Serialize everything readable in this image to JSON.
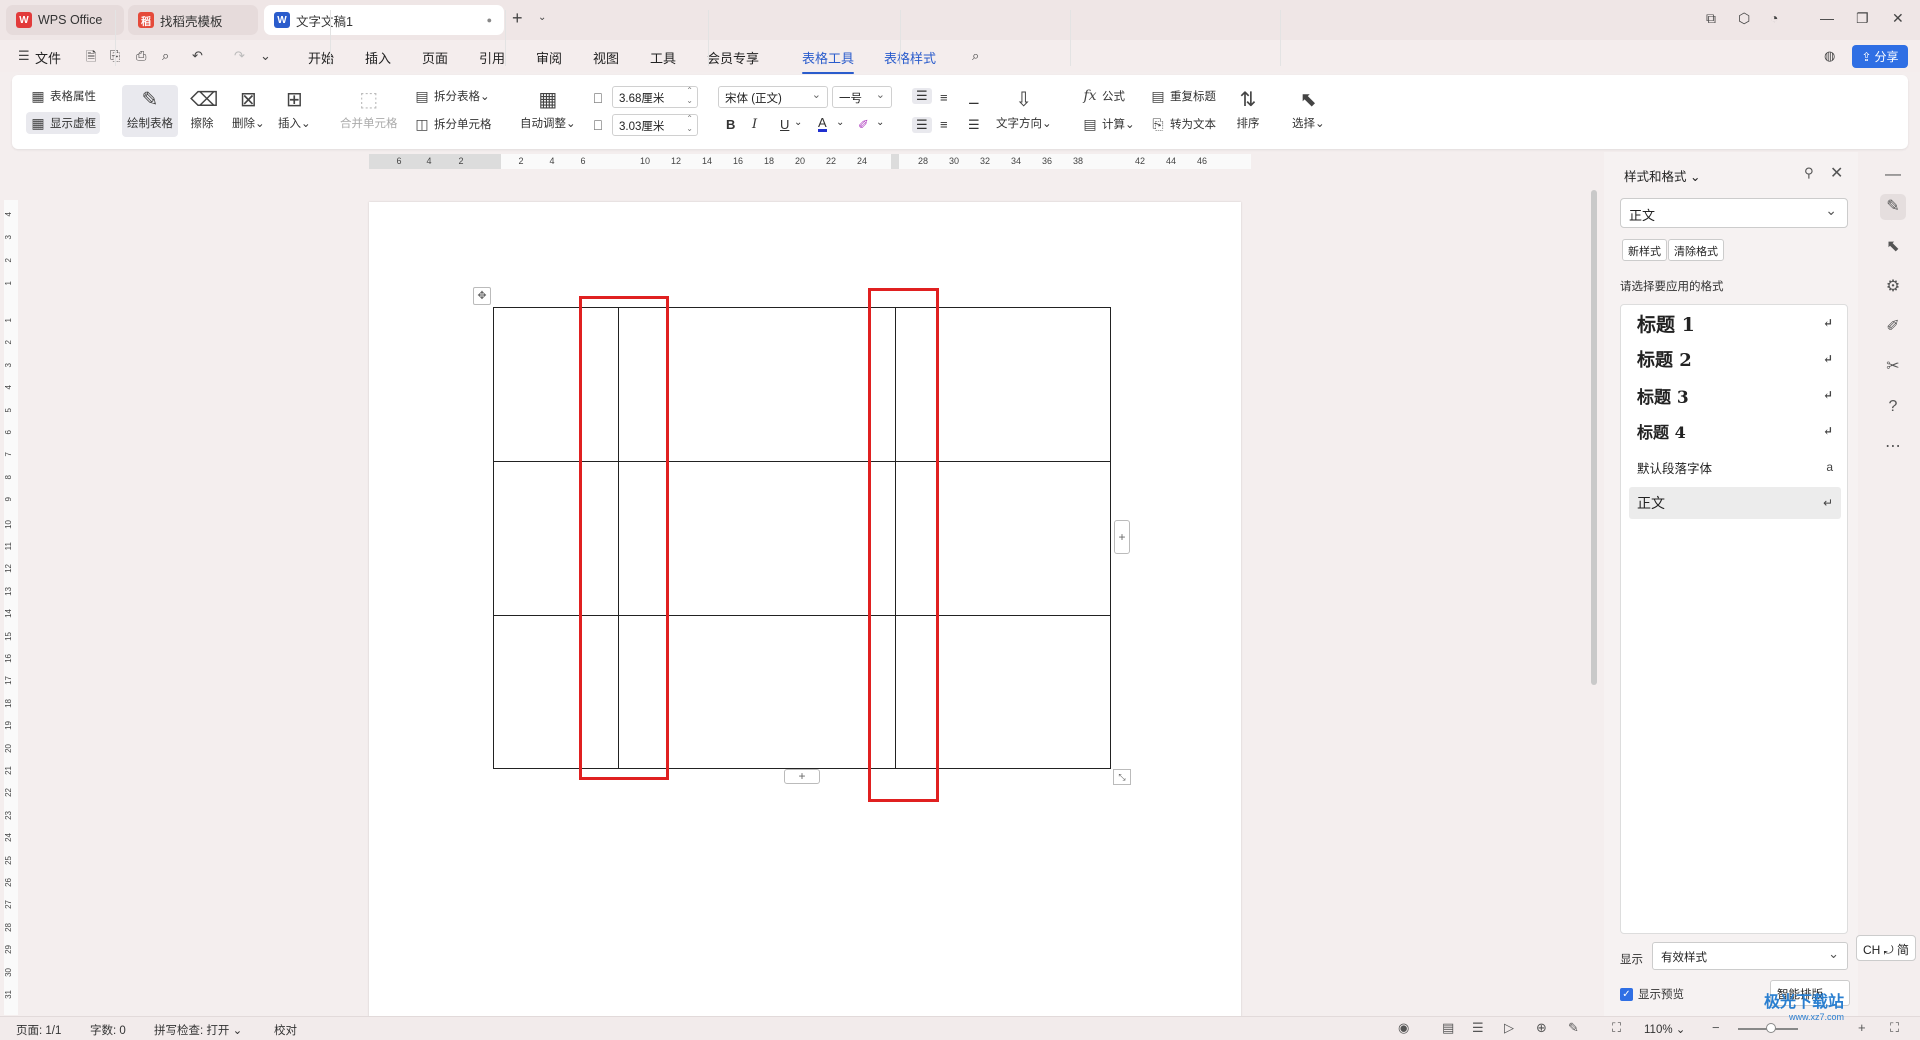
{
  "tabs": [
    {
      "label": "WPS Office",
      "icon": "wps-logo-icon"
    },
    {
      "label": "找稻壳模板",
      "icon": "docer-icon"
    },
    {
      "label": "文字文稿1",
      "icon": "writer-doc-icon",
      "modified_dot": "●"
    }
  ],
  "menu": {
    "file": "文件",
    "items": [
      "开始",
      "插入",
      "页面",
      "引用",
      "审阅",
      "视图",
      "工具",
      "会员专享",
      "表格工具",
      "表格样式"
    ],
    "active": "表格工具",
    "share": "分享"
  },
  "ribbon": {
    "table_props": "表格属性",
    "show_grid": "显示虚框",
    "draw_table": "绘制表格",
    "erase": "擦除",
    "delete": "删除",
    "insert": "插入",
    "merge_cells": "合并单元格",
    "split_table": "拆分表格",
    "split_cells": "拆分单元格",
    "auto_fit": "自动调整",
    "width_value": "3.68厘米",
    "height_value": "3.03厘米",
    "font_name": "宋体 (正文)",
    "font_size": "一号",
    "bold": "B",
    "italic": "I",
    "underline": "U",
    "font_color": "A",
    "text_direction": "文字方向",
    "formula": "公式",
    "calculate": "计算",
    "repeat_header": "重复标题",
    "to_text": "转为文本",
    "sort": "排序",
    "select": "选择"
  },
  "ruler": {
    "h_marks": [
      "6",
      "4",
      "2",
      "2",
      "4",
      "6",
      "10",
      "12",
      "14",
      "16",
      "18",
      "20",
      "22",
      "24",
      "28",
      "30",
      "32",
      "34",
      "36",
      "38",
      "42",
      "44",
      "46"
    ],
    "v_marks": [
      "4",
      "3",
      "2",
      "1",
      "1",
      "2",
      "3",
      "4",
      "5",
      "6",
      "7",
      "8",
      "9",
      "10",
      "11",
      "12",
      "13",
      "14",
      "15",
      "16",
      "17",
      "18",
      "19",
      "20",
      "21",
      "22",
      "23",
      "24",
      "25",
      "26",
      "27",
      "28",
      "29",
      "30",
      "31"
    ]
  },
  "panel": {
    "title": "样式和格式",
    "current_style": "正文",
    "new_style": "新样式",
    "clear_format": "清除格式",
    "apply_label": "请选择要应用的格式",
    "styles": [
      {
        "name": "标题  1",
        "mark": "↵"
      },
      {
        "name": "标题  2",
        "mark": "↵"
      },
      {
        "name": "标题  3",
        "mark": "↵"
      },
      {
        "name": "标题  4",
        "mark": "↵"
      },
      {
        "name": "默认段落字体",
        "mark": "a"
      },
      {
        "name": "正文",
        "mark": "↵"
      }
    ],
    "show_label": "显示",
    "show_value": "有效样式",
    "show_preview": "显示预览",
    "smart_layout": "智能排版"
  },
  "ime": "CH ⤾ 简",
  "status": {
    "page": "页面: 1/1",
    "words": "字数: 0",
    "spell": "拼写检查: 打开",
    "proof": "校对",
    "zoom": "110%"
  },
  "watermark": {
    "title": "极光下载站",
    "url": "www.xz7.com"
  },
  "colors": {
    "accent": "#2a5ccc",
    "highlight_box": "#e02020",
    "share_button": "#2f6fe4"
  }
}
